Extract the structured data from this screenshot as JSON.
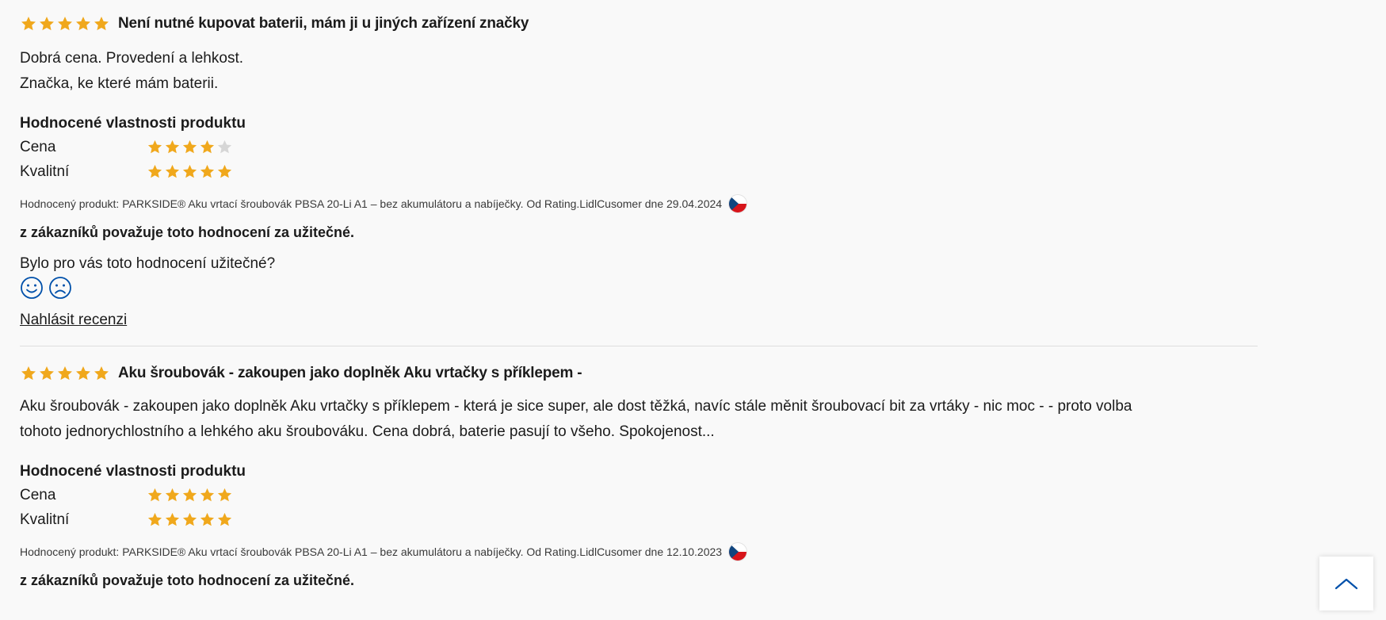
{
  "reviews": [
    {
      "rating": 5,
      "title": "Není nutné kupovat baterii, mám ji u jiných zařízení značky",
      "body_lines": [
        "Dobrá cena. Provedení a lehkost.",
        "Značka, ke které mám baterii."
      ],
      "properties_title": "Hodnocené vlastnosti produktu",
      "properties": [
        {
          "label": "Cena",
          "rating": 4
        },
        {
          "label": "Kvalitní",
          "rating": 5
        }
      ],
      "meta": "Hodnocený produkt: PARKSIDE® Aku vrtací šroubovák PBSA 20-Li A1 – bez akumulátoru a nabíječky. Od Rating.LidlCusomer dne 29.04.2024",
      "helpful_text": "z zákazníků považuje toto hodnocení za užitečné.",
      "question": "Bylo pro vás toto hodnocení užitečné?",
      "report_label": "Nahlásit recenzi"
    },
    {
      "rating": 5,
      "title": "Aku šroubovák - zakoupen jako doplněk Aku vrtačky s příklepem -",
      "body_lines": [
        "Aku šroubovák - zakoupen jako doplněk Aku vrtačky s příklepem - která je sice super, ale dost těžká, navíc stále měnit šroubovací bit za vrtáky - nic moc - - proto volba tohoto jednorychlostního a lehkého aku šroubováku. Cena dobrá, baterie pasují to všeho. Spokojenost..."
      ],
      "properties_title": "Hodnocené vlastnosti produktu",
      "properties": [
        {
          "label": "Cena",
          "rating": 5
        },
        {
          "label": "Kvalitní",
          "rating": 5
        }
      ],
      "meta": "Hodnocený produkt: PARKSIDE® Aku vrtací šroubovák PBSA 20-Li A1 – bez akumulátoru a nabíječky. Od Rating.LidlCusomer dne 12.10.2023",
      "helpful_text": "z zákazníků považuje toto hodnocení za užitečné."
    }
  ],
  "icons": {
    "star": "star-icon",
    "flag": "czech-flag-icon",
    "vote_up": "smiley-happy-icon",
    "vote_down": "smiley-sad-icon",
    "back_to_top": "chevron-up-icon"
  },
  "colors": {
    "star_filled": "#f0a81c",
    "star_empty": "#d6d6d6",
    "accent_blue": "#0050aa",
    "background": "#f9f9f9"
  }
}
